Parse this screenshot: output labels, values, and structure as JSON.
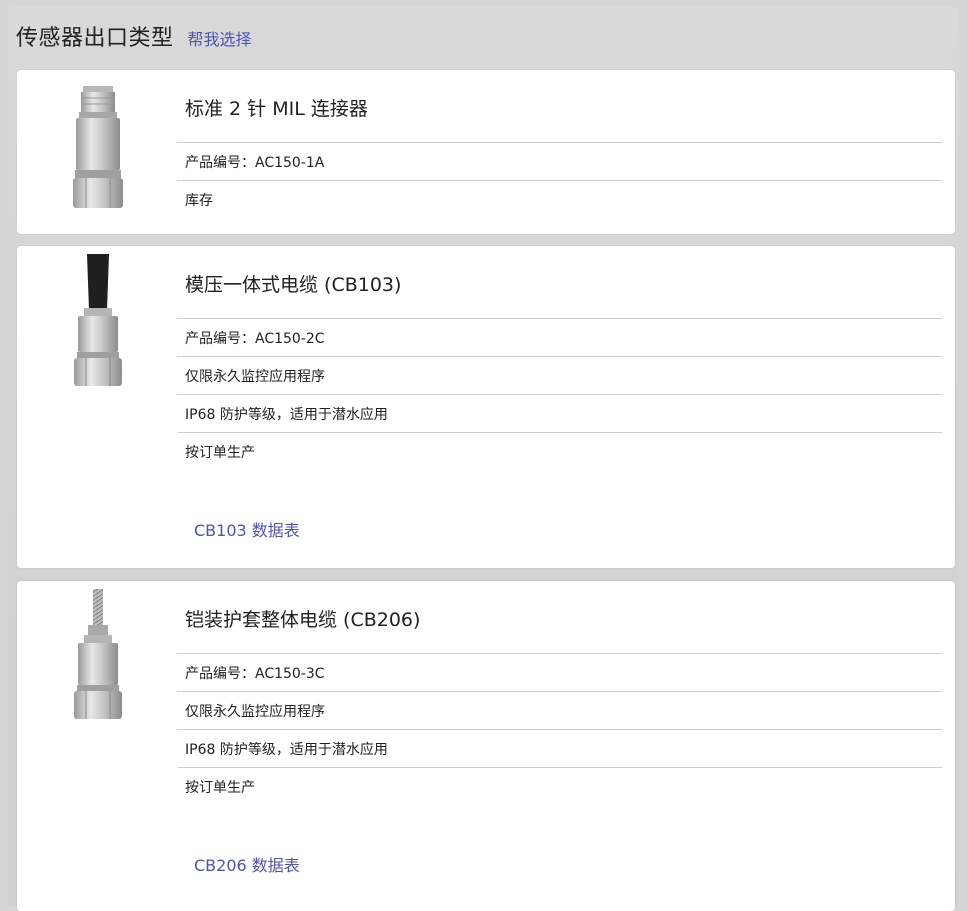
{
  "header": {
    "title": "传感器出口类型",
    "help_link": "帮我选择"
  },
  "products": [
    {
      "title": "标准 2 针 MIL 连接器",
      "rows": [
        "产品编号：AC150-1A",
        "库存"
      ],
      "datasheet": null,
      "image": "mil-connector-sensor-image"
    },
    {
      "title": "模压一体式电缆 (CB103)",
      "rows": [
        "产品编号：AC150-2C",
        "仅限永久监控应用程序",
        "IP68 防护等级，适用于潜水应用",
        "按订单生产"
      ],
      "datasheet": "CB103 数据表",
      "image": "molded-cable-sensor-image"
    },
    {
      "title": "铠装护套整体电缆 (CB206)",
      "rows": [
        "产品编号：AC150-3C",
        "仅限永久监控应用程序",
        "IP68 防护等级，适用于潜水应用",
        "按订单生产"
      ],
      "datasheet": "CB206 数据表",
      "image": "armored-cable-sensor-image"
    }
  ],
  "colors": {
    "link": "#4b55b3",
    "background": "#d6d6d6",
    "card": "#ffffff"
  }
}
